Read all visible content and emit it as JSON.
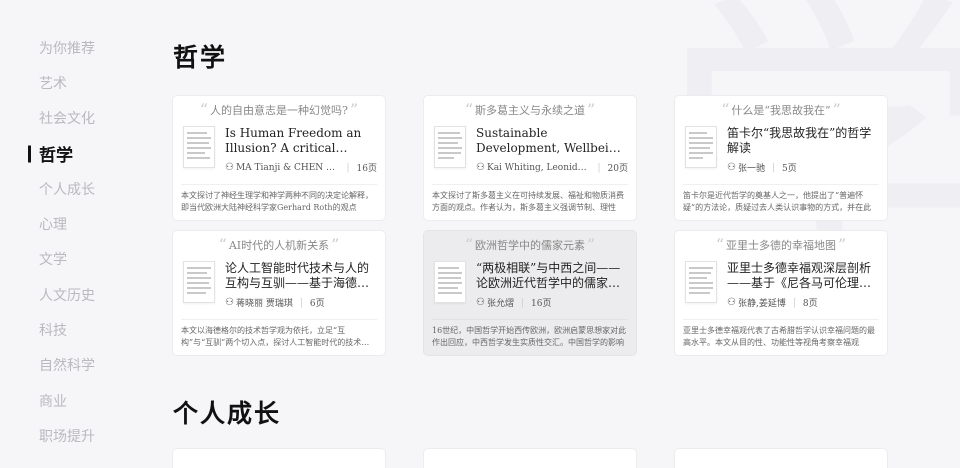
{
  "sidebar": {
    "items": [
      {
        "label": "为你推荐"
      },
      {
        "label": "艺术"
      },
      {
        "label": "社会文化"
      },
      {
        "label": "哲学"
      },
      {
        "label": "个人成长"
      },
      {
        "label": "心理"
      },
      {
        "label": "文学"
      },
      {
        "label": "人文历史"
      },
      {
        "label": "科技"
      },
      {
        "label": "自然科学"
      },
      {
        "label": "商业"
      },
      {
        "label": "职场提升"
      }
    ],
    "active_index": 3
  },
  "background_glyph": "学",
  "sections": [
    {
      "title": "哲学",
      "cards": [
        {
          "tag": "人的自由意志是一种幻觉吗?",
          "title": "Is Human Freedom an Illusion? A critical analysis",
          "author": "MA Tianji & CHEN Szu-Chi",
          "pages": "16页",
          "desc": "本文探讨了神经生理学和神学两种不同的决定论解释，即当代欧洲大陆神经科学家Gerhard Roth的观点"
        },
        {
          "tag": "斯多葛主义与永续之道",
          "title": "Sustainable Development, Wellbeing and Material Consumption",
          "author": "Kai Whiting, Leonidas Konstantakos",
          "pages": "20页",
          "desc": "本文探讨了斯多葛主义在可持续发展、福祉和物质消费方面的观点。作者认为，斯多葛主义强调节制、理性"
        },
        {
          "tag": "什么是“我思故我在”",
          "title": "笛卡尔“我思故我在”的哲学解读",
          "author": "张一驰",
          "pages": "5页",
          "desc": "笛卡尔是近代哲学的奠基人之一，他提出了“普遍怀疑”的方法论，质疑过去人类认识事物的方式，并在此"
        },
        {
          "tag": "AI时代的人机新关系",
          "title": "论人工智能时代技术与人的互构与互驯——基于海德格尔技术哲学",
          "author": "蒋晓丽 贾瑞琪",
          "pages": "6页",
          "desc": "本文以海德格尔的技术哲学观为依托，立足“互构”与“互驯”两个切入点，探讨人工智能时代的技术与人的关系"
        },
        {
          "tag": "欧洲哲学中的儒家元素",
          "title": "“两极相联”与中西之间——论欧洲近代哲学中的儒家哲学元素",
          "author": "张允熠",
          "pages": "16页",
          "desc": "16世纪，中国哲学开始西传欧洲，欧洲启蒙思想家对此作出回应，中西哲学发生实质性交汇。中国哲学的影响"
        },
        {
          "tag": "亚里士多德的幸福地图",
          "title": "亚里士多德幸福观深层剖析——基于《尼各马可伦理学》文本",
          "author": "张静,姜延博",
          "pages": "8页",
          "desc": "亚里士多德幸福观代表了古希腊哲学认识幸福问题的最高水平。本文从目的性、功能性等视角考察幸福观"
        }
      ]
    },
    {
      "title": "个人成长",
      "cards": []
    }
  ]
}
